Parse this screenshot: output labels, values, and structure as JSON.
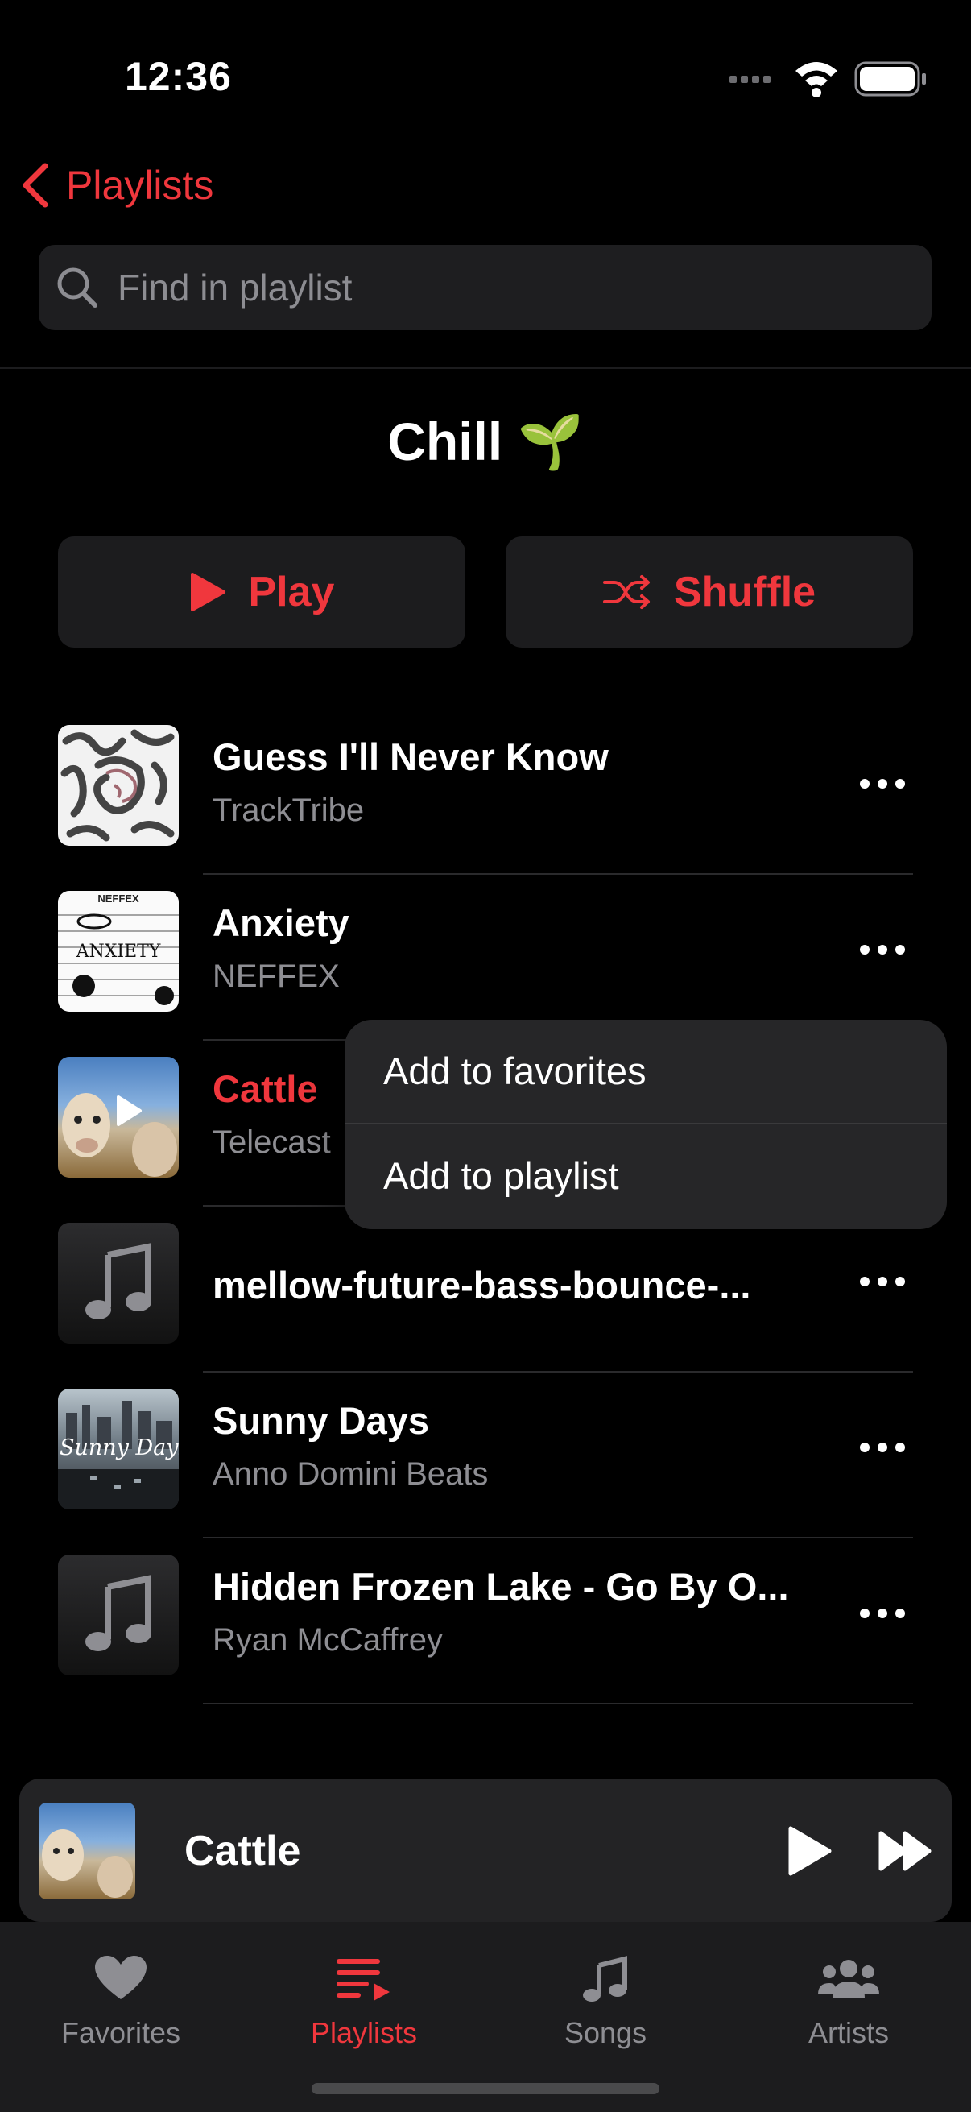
{
  "status_bar": {
    "time": "12:36"
  },
  "nav": {
    "back_label": "Playlists"
  },
  "search": {
    "placeholder": "Find in playlist"
  },
  "playlist": {
    "title": "Chill 🌱"
  },
  "actions": {
    "play_label": "Play",
    "shuffle_label": "Shuffle"
  },
  "songs": [
    {
      "title": "Guess I'll Never Know",
      "artist": "TrackTribe"
    },
    {
      "title": "Anxiety",
      "artist": "NEFFEX"
    },
    {
      "title": "Cattle",
      "artist": "Telecast",
      "playing": true
    },
    {
      "title": "mellow-future-bass-bounce-...",
      "artist": ""
    },
    {
      "title": "Sunny Days",
      "artist": "Anno Domini Beats"
    },
    {
      "title": "Hidden Frozen Lake - Go By O...",
      "artist": "Ryan McCaffrey"
    }
  ],
  "art_text": {
    "anxiety": "ANXIETY",
    "neffex": "NEFFEX",
    "sunny": "Sunny Days"
  },
  "context_menu": {
    "items": [
      "Add to favorites",
      "Add to playlist"
    ]
  },
  "mini_player": {
    "title": "Cattle"
  },
  "tabs": [
    {
      "label": "Favorites",
      "icon": "heart-icon",
      "active": false
    },
    {
      "label": "Playlists",
      "icon": "playlist-icon",
      "active": true
    },
    {
      "label": "Songs",
      "icon": "music-note-icon",
      "active": false
    },
    {
      "label": "Artists",
      "icon": "people-icon",
      "active": false
    }
  ],
  "colors": {
    "accent": "#f0373d",
    "background": "#000000",
    "secondary_text": "#8e8e93"
  }
}
